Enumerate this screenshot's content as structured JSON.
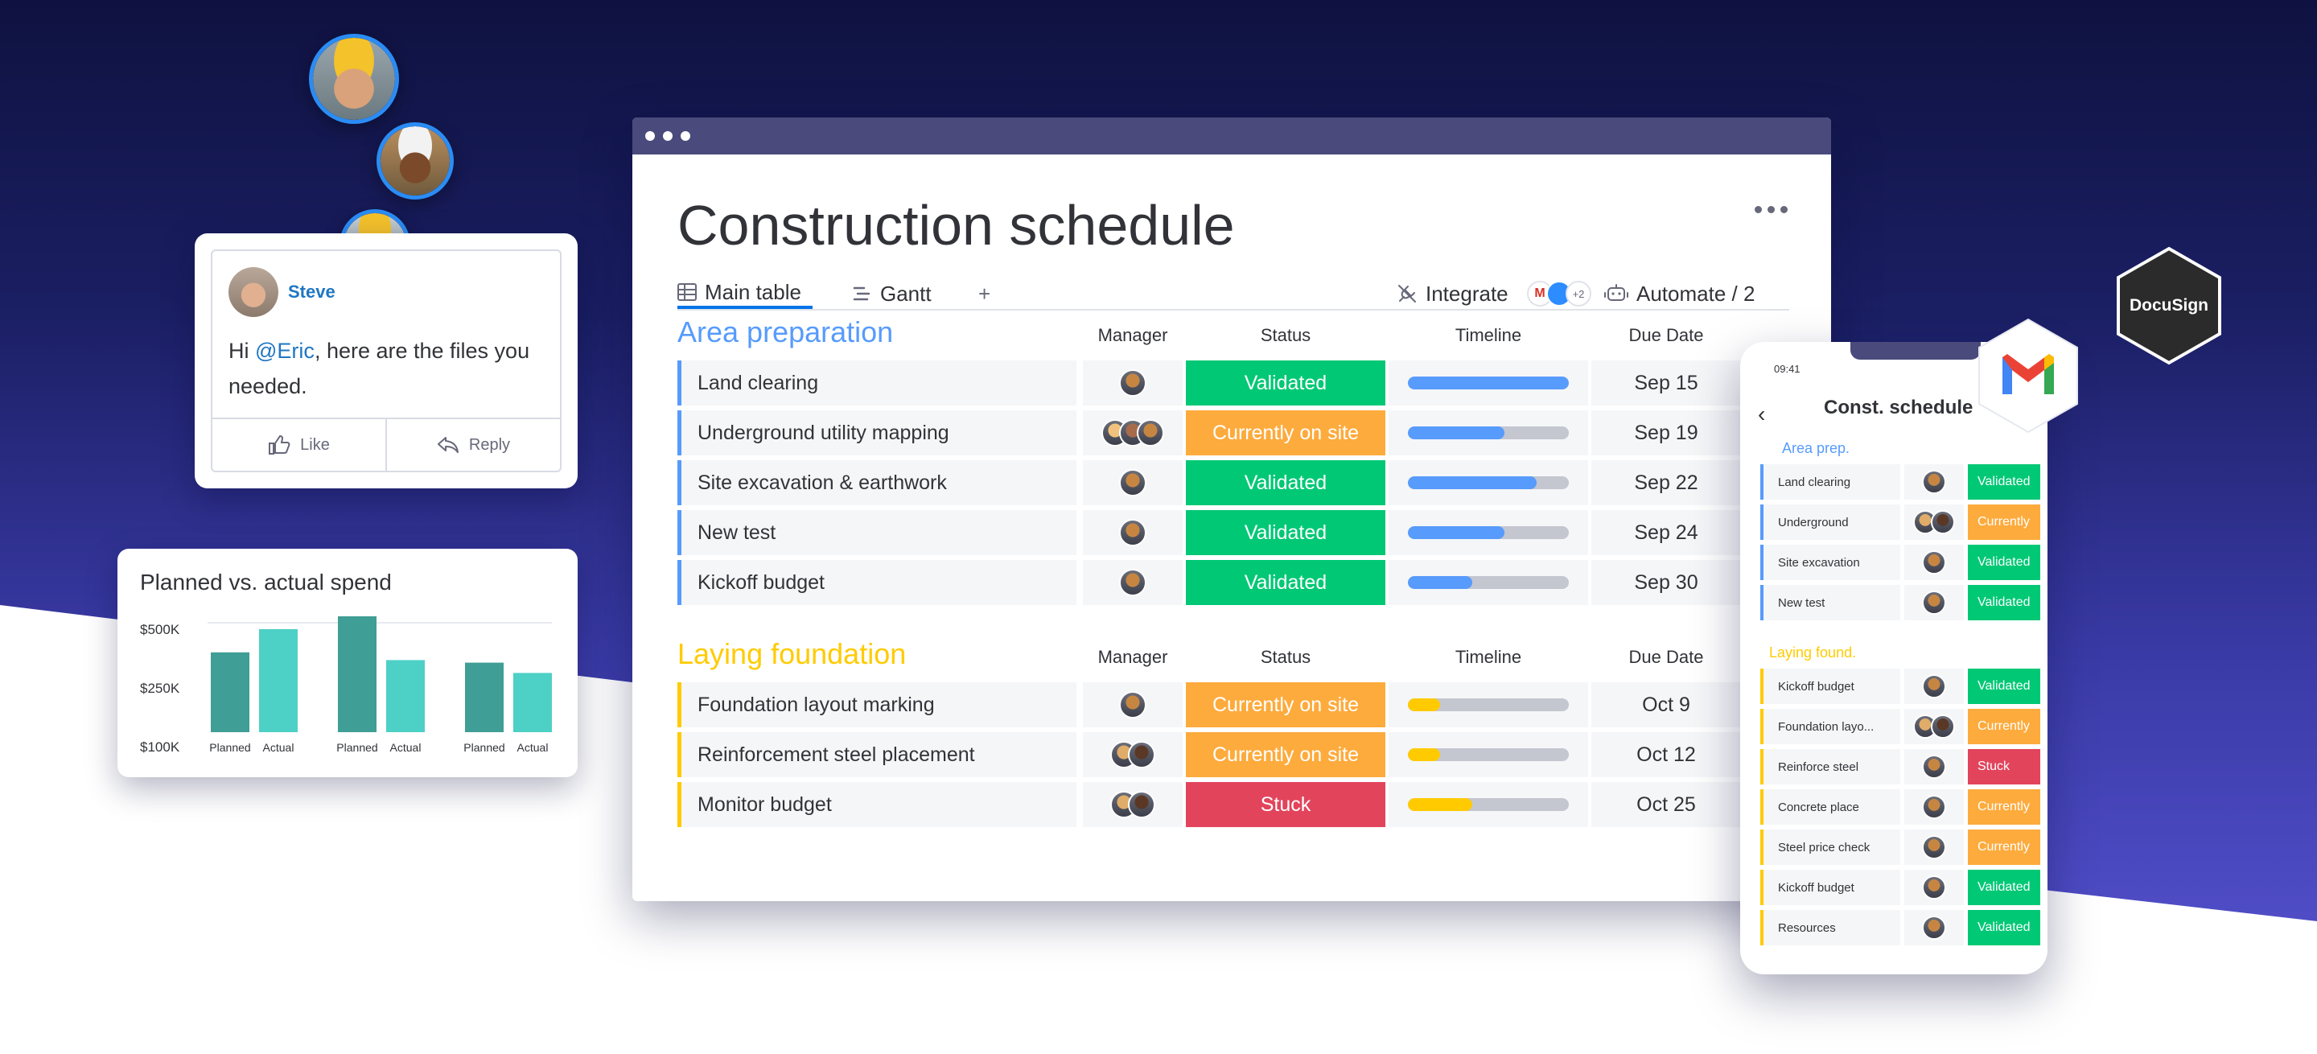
{
  "comment": {
    "author": "Steve",
    "greeting": "Hi",
    "mention": "@Eric",
    "message": ",  here are the files you needed.",
    "like_label": "Like",
    "reply_label": "Reply"
  },
  "spend_chart": {
    "title": "Planned vs. actual spend",
    "chart_data": {
      "type": "bar",
      "title": "Planned vs. actual spend",
      "yticks": [
        "$500K",
        "$250K",
        "$100K"
      ],
      "categories": [
        "Planned",
        "Actual",
        "Planned",
        "Actual",
        "Planned",
        "Actual"
      ],
      "values": [
        310,
        400,
        450,
        280,
        270,
        230
      ],
      "ylim": [
        100,
        500
      ],
      "colors": {
        "Planned": "#3f9e95",
        "Actual": "#4dd0c6"
      }
    }
  },
  "board": {
    "title": "Construction schedule",
    "tabs": [
      "Main table",
      "Gantt"
    ],
    "add_tab": "+",
    "integrate_label": "Integrate",
    "integrate_count": "+2",
    "automate_label": "Automate / 2",
    "columns": {
      "manager": "Manager",
      "status": "Status",
      "timeline": "Timeline",
      "due": "Due Date"
    },
    "groups": [
      {
        "title": "Area preparation",
        "color": "#579bfc",
        "rows": [
          {
            "name": "Land clearing",
            "status": "Validated",
            "status_color": "#00c875",
            "progress": 1.0,
            "due": "Sep 15",
            "managers": 1
          },
          {
            "name": "Underground utility mapping",
            "status": "Currently on site",
            "status_color": "#fdab3d",
            "progress": 0.6,
            "due": "Sep 19",
            "managers": 3
          },
          {
            "name": "Site excavation & earthwork",
            "status": "Validated",
            "status_color": "#00c875",
            "progress": 0.8,
            "due": "Sep 22",
            "managers": 1
          },
          {
            "name": "New test",
            "status": "Validated",
            "status_color": "#00c875",
            "progress": 0.6,
            "due": "Sep 24",
            "managers": 1
          },
          {
            "name": "Kickoff budget",
            "status": "Validated",
            "status_color": "#00c875",
            "progress": 0.4,
            "due": "Sep 30",
            "managers": 1
          }
        ]
      },
      {
        "title": "Laying foundation",
        "color": "#ffcb00",
        "rows": [
          {
            "name": "Foundation layout marking",
            "status": "Currently on site",
            "status_color": "#fdab3d",
            "progress": 0.2,
            "due": "Oct 9",
            "managers": 1
          },
          {
            "name": "Reinforcement steel placement",
            "status": "Currently on site",
            "status_color": "#fdab3d",
            "progress": 0.2,
            "due": "Oct 12",
            "managers": 2
          },
          {
            "name": "Monitor budget",
            "status": "Stuck",
            "status_color": "#e2445c",
            "progress": 0.4,
            "due": "Oct 25",
            "managers": 2
          }
        ]
      }
    ]
  },
  "phone": {
    "time": "09:41",
    "title": "Const. schedule",
    "groups": [
      {
        "title": "Area prep.",
        "color": "#579bfc",
        "rows": [
          {
            "name": "Land clearing",
            "status": "Validated",
            "status_color": "#00c875",
            "managers": 1
          },
          {
            "name": "Underground",
            "status": "Currently",
            "status_color": "#fdab3d",
            "managers": 2
          },
          {
            "name": "Site excavation",
            "status": "Validated",
            "status_color": "#00c875",
            "managers": 1
          },
          {
            "name": "New test",
            "status": "Validated",
            "status_color": "#00c875",
            "managers": 1
          }
        ]
      },
      {
        "title": "Laying found.",
        "color": "#ffcb00",
        "rows": [
          {
            "name": "Kickoff budget",
            "status": "Validated",
            "status_color": "#00c875",
            "managers": 1
          },
          {
            "name": "Foundation layo...",
            "status": "Currently",
            "status_color": "#fdab3d",
            "managers": 2
          },
          {
            "name": "Reinforce steel",
            "status": "Stuck",
            "status_color": "#e2445c",
            "managers": 1
          },
          {
            "name": "Concrete place",
            "status": "Currently",
            "status_color": "#fdab3d",
            "managers": 1
          },
          {
            "name": "Steel price check",
            "status": "Currently",
            "status_color": "#fdab3d",
            "managers": 1
          },
          {
            "name": "Kickoff budget",
            "status": "Validated",
            "status_color": "#00c875",
            "managers": 1
          },
          {
            "name": "Resources",
            "status": "Validated",
            "status_color": "#00c875",
            "managers": 1
          }
        ]
      }
    ]
  },
  "badges": {
    "docusign": "DocuSign",
    "gmail_icon": "gmail-icon"
  }
}
